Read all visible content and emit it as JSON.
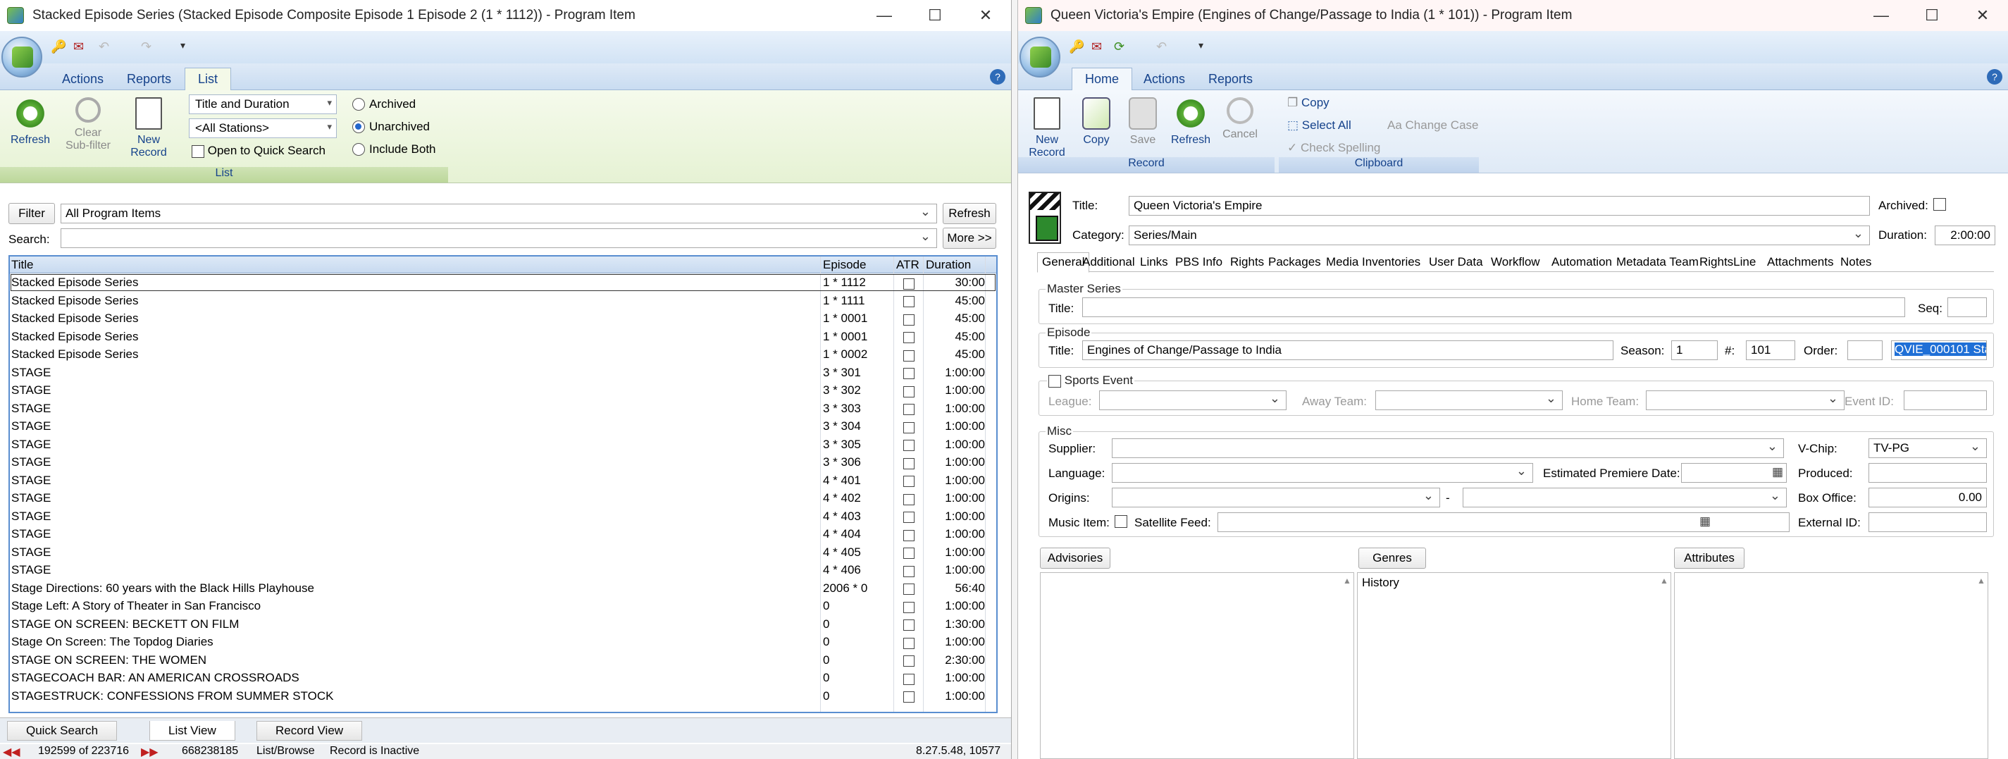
{
  "left": {
    "title": "Stacked Episode Series (Stacked Episode Composite Episode 1 Episode 2 (1 * 1112)) - Program Item",
    "tabs": [
      "Actions",
      "Reports",
      "List"
    ],
    "ribbon": {
      "refresh": "Refresh",
      "clear_subfilter": "Clear Sub-filter",
      "new_record": "New Record",
      "sort_combo": "Title and Duration",
      "stations_combo": "<All Stations>",
      "open_quick_search": "Open to Quick Search",
      "radio_archived": "Archived",
      "radio_unarchived": "Unarchived",
      "radio_both": "Include Both",
      "group_list": "List"
    },
    "filter": {
      "filter_btn": "Filter",
      "filter_value": "All Program Items",
      "refresh_btn": "Refresh",
      "search_label": "Search:",
      "search_value": "",
      "more_btn": "More >>"
    },
    "grid": {
      "headers": [
        "Title",
        "Episode",
        "ATR",
        "Duration"
      ],
      "rows": [
        {
          "title": "Stacked Episode Series",
          "episode": "1 * 1112",
          "duration": "30:00"
        },
        {
          "title": "Stacked Episode Series",
          "episode": "1 * 1111",
          "duration": "45:00"
        },
        {
          "title": "Stacked Episode Series",
          "episode": "1 * 0001",
          "duration": "45:00"
        },
        {
          "title": "Stacked Episode Series",
          "episode": "1 * 0001",
          "duration": "45:00"
        },
        {
          "title": "Stacked Episode Series",
          "episode": "1 * 0002",
          "duration": "45:00"
        },
        {
          "title": "STAGE",
          "episode": "3 * 301",
          "duration": "1:00:00"
        },
        {
          "title": "STAGE",
          "episode": "3 * 302",
          "duration": "1:00:00"
        },
        {
          "title": "STAGE",
          "episode": "3 * 303",
          "duration": "1:00:00"
        },
        {
          "title": "STAGE",
          "episode": "3 * 304",
          "duration": "1:00:00"
        },
        {
          "title": "STAGE",
          "episode": "3 * 305",
          "duration": "1:00:00"
        },
        {
          "title": "STAGE",
          "episode": "3 * 306",
          "duration": "1:00:00"
        },
        {
          "title": "STAGE",
          "episode": "4 * 401",
          "duration": "1:00:00"
        },
        {
          "title": "STAGE",
          "episode": "4 * 402",
          "duration": "1:00:00"
        },
        {
          "title": "STAGE",
          "episode": "4 * 403",
          "duration": "1:00:00"
        },
        {
          "title": "STAGE",
          "episode": "4 * 404",
          "duration": "1:00:00"
        },
        {
          "title": "STAGE",
          "episode": "4 * 405",
          "duration": "1:00:00"
        },
        {
          "title": "STAGE",
          "episode": "4 * 406",
          "duration": "1:00:00"
        },
        {
          "title": "Stage Directions: 60 years with the Black Hills Playhouse",
          "episode": "2006 * 0",
          "duration": "56:40"
        },
        {
          "title": "Stage Left: A Story of  Theater in San Francisco",
          "episode": "0",
          "duration": "1:00:00"
        },
        {
          "title": "STAGE ON SCREEN: BECKETT ON FILM",
          "episode": "0",
          "duration": "1:30:00"
        },
        {
          "title": "Stage On Screen: The Topdog Diaries",
          "episode": "0",
          "duration": "1:00:00"
        },
        {
          "title": "STAGE ON SCREEN: THE WOMEN",
          "episode": "0",
          "duration": "2:30:00"
        },
        {
          "title": "STAGECOACH BAR: AN AMERICAN CROSSROADS",
          "episode": "0",
          "duration": "1:00:00"
        },
        {
          "title": "STAGESTRUCK: CONFESSIONS FROM SUMMER STOCK",
          "episode": "0",
          "duration": "1:00:00"
        }
      ]
    },
    "bottom_tabs": [
      "Quick Search",
      "List View",
      "Record View"
    ],
    "status": {
      "position": "192599 of 223716",
      "id": "668238185",
      "mode": "List/Browse",
      "record_state": "Record is Inactive",
      "version": "8.27.5.48, 10577"
    }
  },
  "right": {
    "title": "Queen Victoria's Empire (Engines of Change/Passage to India (1 * 101)) - Program Item",
    "tabs": [
      "Home",
      "Actions",
      "Reports"
    ],
    "ribbon": {
      "new_record": "New Record",
      "copy": "Copy",
      "save": "Save",
      "refresh": "Refresh",
      "cancel": "Cancel",
      "clip_copy": "Copy",
      "select_all": "Select All",
      "change_case": "Change Case",
      "check_spelling": "Check Spelling",
      "group_record": "Record",
      "group_clipboard": "Clipboard"
    },
    "header": {
      "title_label": "Title:",
      "title_value": "Queen Victoria's Empire",
      "archived_label": "Archived:",
      "category_label": "Category:",
      "category_value": "Series/Main",
      "duration_label": "Duration:",
      "duration_value": "2:00:00"
    },
    "subtabs": [
      "General",
      "Additional",
      "Links",
      "PBS Info",
      "Rights",
      "Packages",
      "Media Inventories",
      "User Data",
      "Workflow",
      "Automation",
      "Metadata Team",
      "RightsLine",
      "Attachments",
      "Notes"
    ],
    "master_series": {
      "section": "Master Series",
      "title_label": "Title:",
      "title_value": "",
      "seq_label": "Seq:",
      "seq_value": ""
    },
    "episode": {
      "section": "Episode",
      "title_label": "Title:",
      "title_value": "Engines of Change/Passage to India",
      "season_label": "Season:",
      "season_value": "1",
      "num_label": "#:",
      "num_value": "101",
      "order_label": "Order:",
      "order_value": "",
      "code_value": "QVIE_000101 Sta"
    },
    "sports": {
      "label": "Sports Event",
      "league": "League:",
      "away": "Away Team:",
      "home": "Home Team:",
      "event_id": "Event ID:"
    },
    "misc": {
      "section": "Misc",
      "supplier": "Supplier:",
      "vchip_label": "V-Chip:",
      "vchip_value": "TV-PG",
      "language": "Language:",
      "est_premiere": "Estimated Premiere Date:",
      "produced": "Produced:",
      "origins": "Origins:",
      "dash": "-",
      "box_office_label": "Box Office:",
      "box_office_value": "0.00",
      "music_item": "Music Item:",
      "satellite_feed": "Satellite Feed:",
      "external_id": "External ID:"
    },
    "lists": {
      "advisories": "Advisories",
      "genres": "Genres",
      "attributes": "Attributes",
      "genre_item": "History"
    }
  }
}
